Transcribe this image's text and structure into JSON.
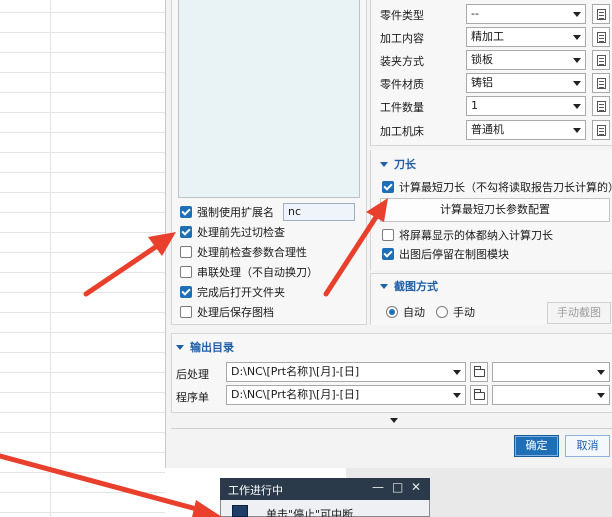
{
  "left_options": {
    "items": [
      {
        "label": "强制使用扩展名",
        "checked": true,
        "value": "nc"
      },
      {
        "label": "处理前先过切检查",
        "checked": true
      },
      {
        "label": "处理前检查参数合理性",
        "checked": false
      },
      {
        "label": "串联处理（不自动换刀）",
        "checked": false
      },
      {
        "label": "完成后打开文件夹",
        "checked": true
      },
      {
        "label": "处理后保存图档",
        "checked": false
      }
    ]
  },
  "properties": {
    "rows": [
      {
        "label": "零件类型",
        "value": "--"
      },
      {
        "label": "加工内容",
        "value": "精加工"
      },
      {
        "label": "装夹方式",
        "value": "锁板"
      },
      {
        "label": "零件材质",
        "value": "铸铝"
      },
      {
        "label": "工件数量",
        "value": "1"
      },
      {
        "label": "加工机床",
        "value": "普通机"
      }
    ]
  },
  "tool_section": {
    "title": "刀长",
    "calc_shortest": {
      "label": "计算最短刀长（不勾将读取报告刀长计算的）",
      "checked": true
    },
    "config_button": "计算最短刀长参数配置",
    "screen_body": {
      "label": "将屏幕显示的体都纳入计算刀长",
      "checked": false
    },
    "stay_module": {
      "label": "出图后停留在制图模块",
      "checked": true
    }
  },
  "screenshot_section": {
    "title": "截图方式",
    "auto_label": "自动",
    "manual_label": "手动",
    "selected": "自动",
    "manual_button": "手动截图"
  },
  "output_section": {
    "title": "输出目录",
    "rows": [
      {
        "label": "后处理",
        "path": "D:\\NC\\[Prt名称]\\[月]-[日]"
      },
      {
        "label": "程序单",
        "path": "D:\\NC\\[Prt名称]\\[月]-[日]"
      }
    ]
  },
  "buttons": {
    "ok": "确定",
    "cancel": "取消"
  },
  "progress_window": {
    "title": "工作进行中",
    "message": "单击\"停止\"可中断"
  },
  "colors": {
    "accent": "#1f6fb7",
    "arrow": "#e8402c",
    "section_head": "#1f5fa8"
  }
}
